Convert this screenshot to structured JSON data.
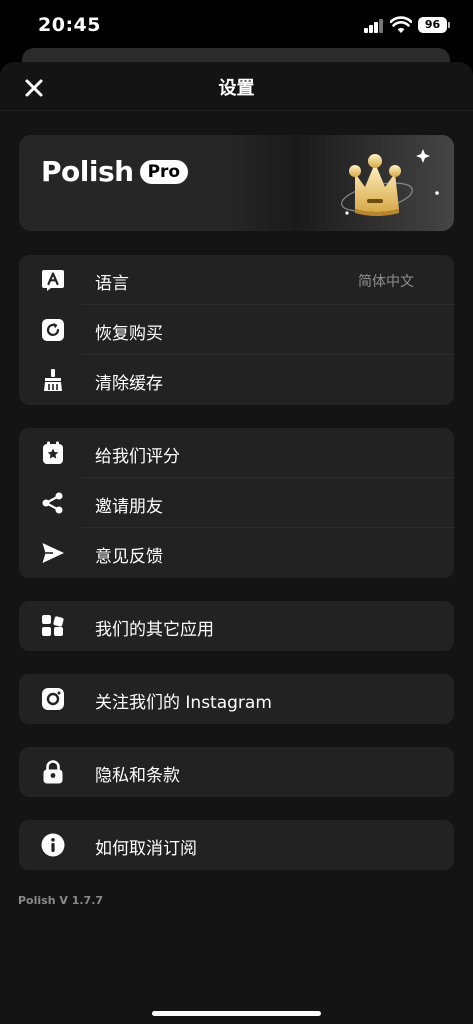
{
  "status": {
    "time": "20:45",
    "battery": "96"
  },
  "header": {
    "title": "设置"
  },
  "banner": {
    "logo_text": "Polish",
    "badge": "Pro"
  },
  "sections": {
    "general": [
      {
        "label": "语言",
        "value": "简体中文",
        "icon": "translate-icon"
      },
      {
        "label": "恢复购买",
        "icon": "restore-icon"
      },
      {
        "label": "清除缓存",
        "icon": "broom-icon"
      }
    ],
    "feedback": [
      {
        "label": "给我们评分",
        "icon": "star-icon"
      },
      {
        "label": "邀请朋友",
        "icon": "share-icon"
      },
      {
        "label": "意见反馈",
        "icon": "send-icon"
      }
    ],
    "other_apps": {
      "label": "我们的其它应用",
      "icon": "apps-grid-icon"
    },
    "instagram": {
      "label": "关注我们的 Instagram",
      "icon": "instagram-icon"
    },
    "privacy": {
      "label": "隐私和条款",
      "icon": "lock-icon"
    },
    "unsubscribe": {
      "label": "如何取消订阅",
      "icon": "info-icon"
    }
  },
  "footer": {
    "version": "Polish V 1.7.7"
  }
}
